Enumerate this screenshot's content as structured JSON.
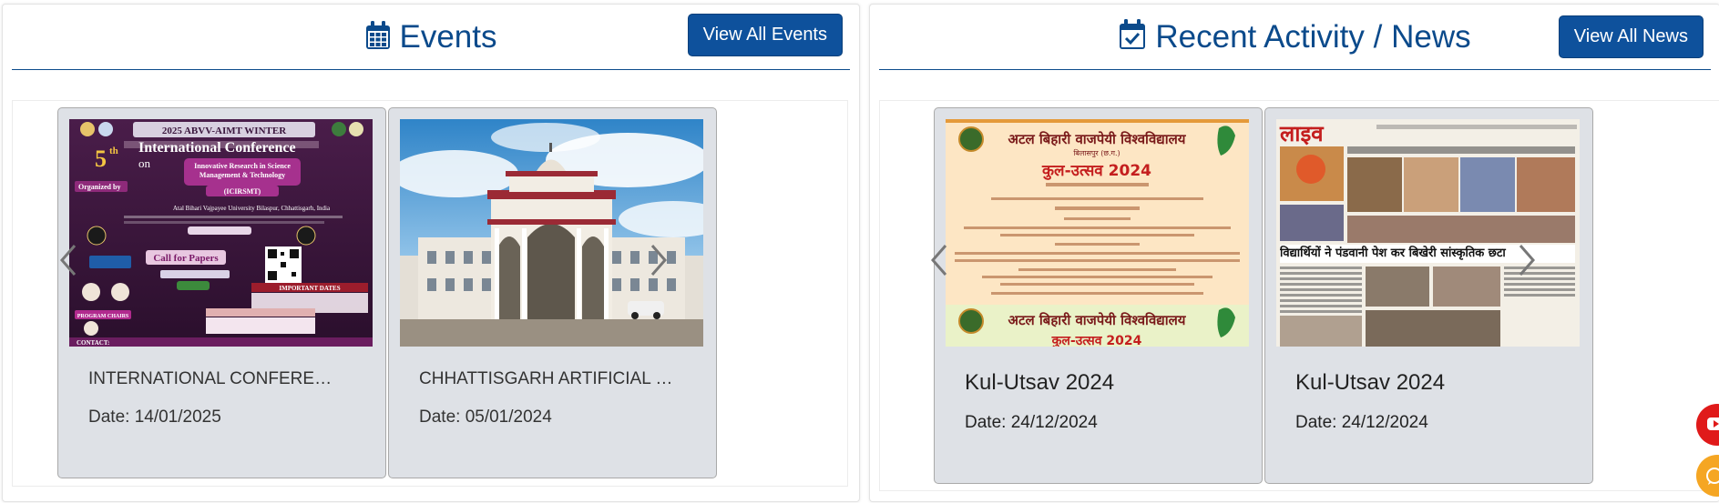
{
  "events": {
    "title": "Events",
    "icon": "calendar-icon",
    "view_all_label": "View All Events",
    "cards": [
      {
        "title": "INTERNATIONAL CONFERE…",
        "date": "Date: 14/01/2025",
        "poster": {
          "banner": "2025 ABVV-AIMT WINTER",
          "edition": "5",
          "edition_suffix": "th",
          "heading": "International Conference",
          "on": "on",
          "theme": "Innovative Research in Science Management & Technology",
          "acronym": "(ICIRSMT)",
          "organized_by": "Organized by",
          "university": "Atal Bihari Vajpayee University Bilaspur, Chhattisgarh, India",
          "call": "Call for Papers",
          "dates_header": "IMPORTANT DATES",
          "committee": "PROGRAM CHAIRS",
          "contact": "CONTACT:"
        }
      },
      {
        "title": "CHHATTISGARH ARTIFICIAL …",
        "date": "Date: 05/01/2024"
      }
    ]
  },
  "news": {
    "title": "Recent Activity / News",
    "icon": "calendar-check-icon",
    "view_all_label": "View All News",
    "cards": [
      {
        "title": "Kul-Utsav 2024",
        "date": "Date: 24/12/2024",
        "poster": {
          "banner": "अटल बिहारी वाजपेयी विश्वविद्यालय",
          "subtitle": "बिलासपुर (छ.ग.)",
          "event": "कुल-उत्सव 2024"
        }
      },
      {
        "title": "Kul-Utsav 2024",
        "date": "Date: 24/12/2024",
        "poster": {
          "paper": "लाइव",
          "headline": "विद्यार्थियों ने पंडवानी पेश कर बिखेरी सांस्कृतिक छटा"
        }
      }
    ]
  },
  "colors": {
    "brand_blue": "#0b4a8b",
    "button_blue": "#0e519c",
    "card_bg": "#dee1e6",
    "youtube_red": "#e01a1a",
    "whatsapp_orange": "#f5a623"
  }
}
